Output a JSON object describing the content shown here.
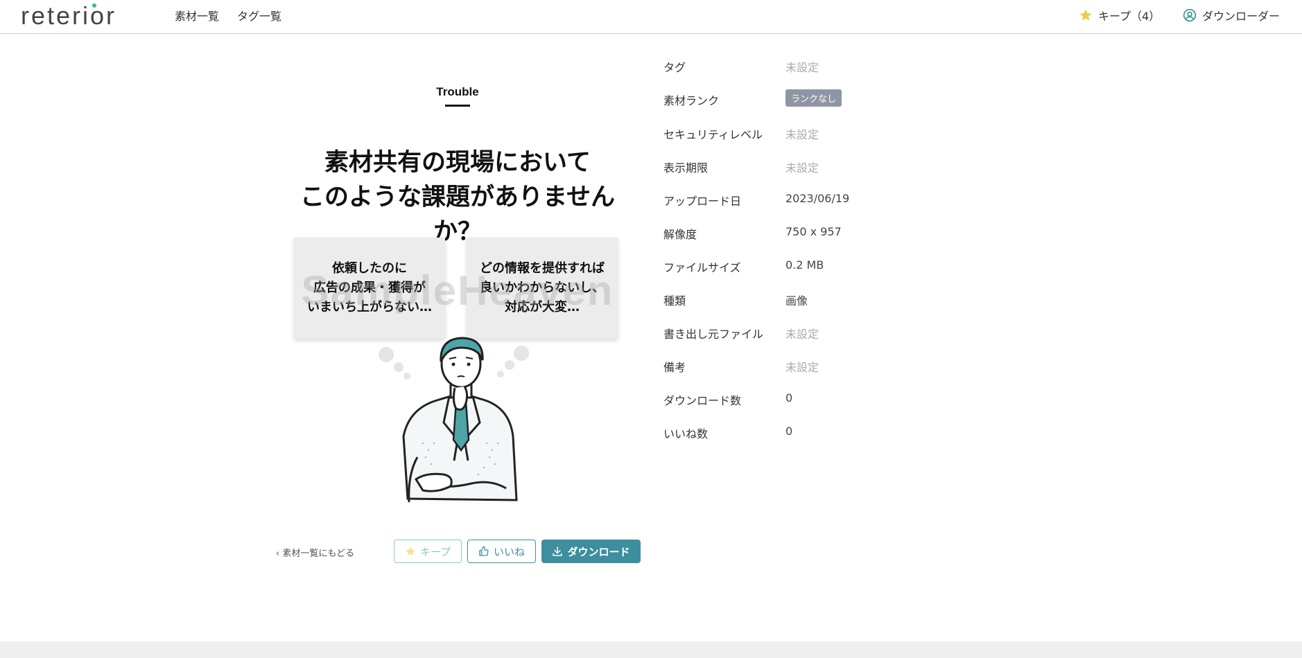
{
  "header": {
    "logo": "reterior",
    "nav": [
      "素材一覧",
      "タグ一覧"
    ],
    "keep": "キープ（4）",
    "user": "ダウンローダー"
  },
  "preview": {
    "label": "Trouble",
    "headline_line1": "素材共有の現場において",
    "headline_line2": "このような課題がありませんか？",
    "card_left": [
      "依頼したのに",
      "広告の成果・獲得が",
      "いまいち上がらない…"
    ],
    "card_right": [
      "どの情報を提供すれば",
      "良いかわからないし、",
      "対応が大変…"
    ],
    "watermark": "SampleHeaven"
  },
  "actions": {
    "back": "素材一覧にもどる",
    "keep": "キープ",
    "like": "いいね",
    "download": "ダウンロード"
  },
  "meta": [
    {
      "label": "タグ",
      "value": "未設定"
    },
    {
      "label": "素材ランク",
      "value": "ランクなし"
    },
    {
      "label": "セキュリティレベル",
      "value": "未設定"
    },
    {
      "label": "表示期限",
      "value": "未設定"
    },
    {
      "label": "アップロード日",
      "value": "2023/06/19"
    },
    {
      "label": "解像度",
      "value": "750 x 957"
    },
    {
      "label": "ファイルサイズ",
      "value": "0.2 MB"
    },
    {
      "label": "種類",
      "value": "画像"
    },
    {
      "label": "書き出し元ファイル",
      "value": "未設定"
    },
    {
      "label": "備考",
      "value": "未設定"
    },
    {
      "label": "ダウンロード数",
      "value": "0"
    },
    {
      "label": "いいね数",
      "value": "0"
    }
  ],
  "colors": {
    "accent": "#3d8f9e",
    "accent_light": "#8cc6cc",
    "star": "#f2c94c",
    "badge": "#8f96a3"
  }
}
